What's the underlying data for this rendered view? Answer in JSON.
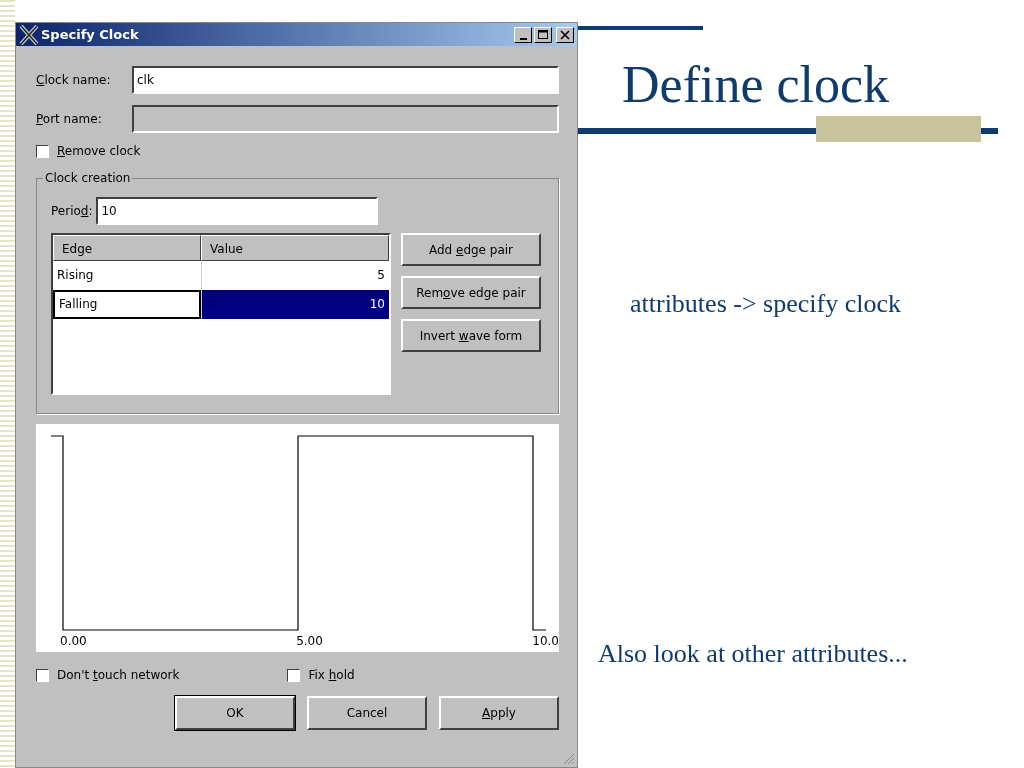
{
  "slide": {
    "title": "Define clock",
    "notes": [
      "attributes -> specify clock",
      "Also look at other attributes..."
    ]
  },
  "window": {
    "title": "Specify Clock",
    "controls": [
      {
        "kind": "minimize"
      },
      {
        "kind": "maximize"
      },
      {
        "kind": "close"
      }
    ]
  },
  "fields": [
    {
      "label": {
        "key": "C",
        "post": "lock name:"
      },
      "value": "clk",
      "disabled": false
    },
    {
      "label": {
        "key": "P",
        "post": "ort name:"
      },
      "disabled": true
    }
  ],
  "remove_clock": {
    "label": {
      "key": "R",
      "post": "emove clock"
    },
    "checked": false
  },
  "clock_creation": {
    "title": "Clock creation",
    "period": {
      "label": {
        "pre": "Perio",
        "key": "d",
        "post": ":"
      },
      "value": "10"
    },
    "table": {
      "columns": [
        "Edge",
        "Value"
      ],
      "rows": [
        {
          "edge": "Rising",
          "value": "5",
          "selected": false
        },
        {
          "edge": "Falling",
          "value": "10",
          "selected": true
        }
      ]
    },
    "buttons": [
      {
        "label": {
          "pre": "Add ",
          "key": "e",
          "post": "dge pair"
        }
      },
      {
        "label": {
          "pre": "Rem",
          "key": "o",
          "post": "ve edge pair"
        }
      },
      {
        "label": {
          "pre": "Invert ",
          "key": "w",
          "post": "ave form"
        }
      }
    ]
  },
  "waveform": {
    "tick_labels": [
      "0.00",
      "5.00",
      "10.0"
    ]
  },
  "options": [
    {
      "label": {
        "pre": "Don't ",
        "key": "t",
        "post": "ouch network"
      },
      "checked": false
    },
    {
      "label": {
        "pre": "Fix ",
        "key": "h",
        "post": "old"
      },
      "checked": false
    }
  ],
  "buttons": [
    {
      "label": {
        "post": "OK"
      },
      "default": true
    },
    {
      "label": {
        "post": "Cancel"
      },
      "default": false
    },
    {
      "label": {
        "key": "A",
        "post": "pply"
      },
      "default": false
    }
  ]
}
